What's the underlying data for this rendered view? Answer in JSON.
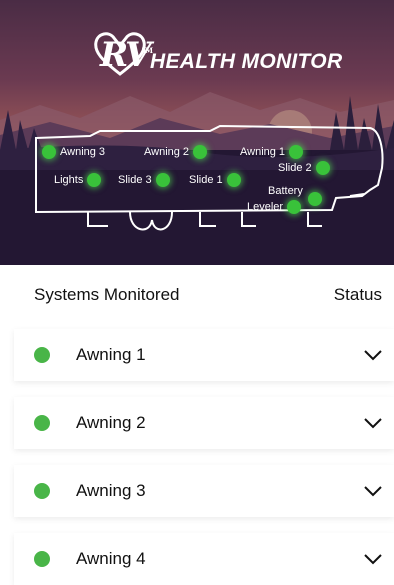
{
  "app": {
    "logo_mark": "RV",
    "logo_tm": "TM",
    "logo_text": "HEALTH MONITOR"
  },
  "hotspots": [
    {
      "label": "Awning 3",
      "id": "awning-3"
    },
    {
      "label": "Awning 2",
      "id": "awning-2"
    },
    {
      "label": "Awning 1",
      "id": "awning-1"
    },
    {
      "label": "Slide 2",
      "id": "slide-2"
    },
    {
      "label": "Lights",
      "id": "lights"
    },
    {
      "label": "Slide 3",
      "id": "slide-3"
    },
    {
      "label": "Slide 1",
      "id": "slide-1"
    },
    {
      "label": "Battery",
      "id": "battery"
    },
    {
      "label": "Leveler",
      "id": "leveler"
    }
  ],
  "table": {
    "header_systems": "Systems Monitored",
    "header_status": "Status"
  },
  "systems": [
    {
      "name": "Awning 1",
      "status_color": "#49b548"
    },
    {
      "name": "Awning 2",
      "status_color": "#49b548"
    },
    {
      "name": "Awning 3",
      "status_color": "#49b548"
    },
    {
      "name": "Awning 4",
      "status_color": "#49b548"
    }
  ],
  "colors": {
    "status_ok": "#49b548",
    "hotspot_glow": "#39c23a"
  }
}
